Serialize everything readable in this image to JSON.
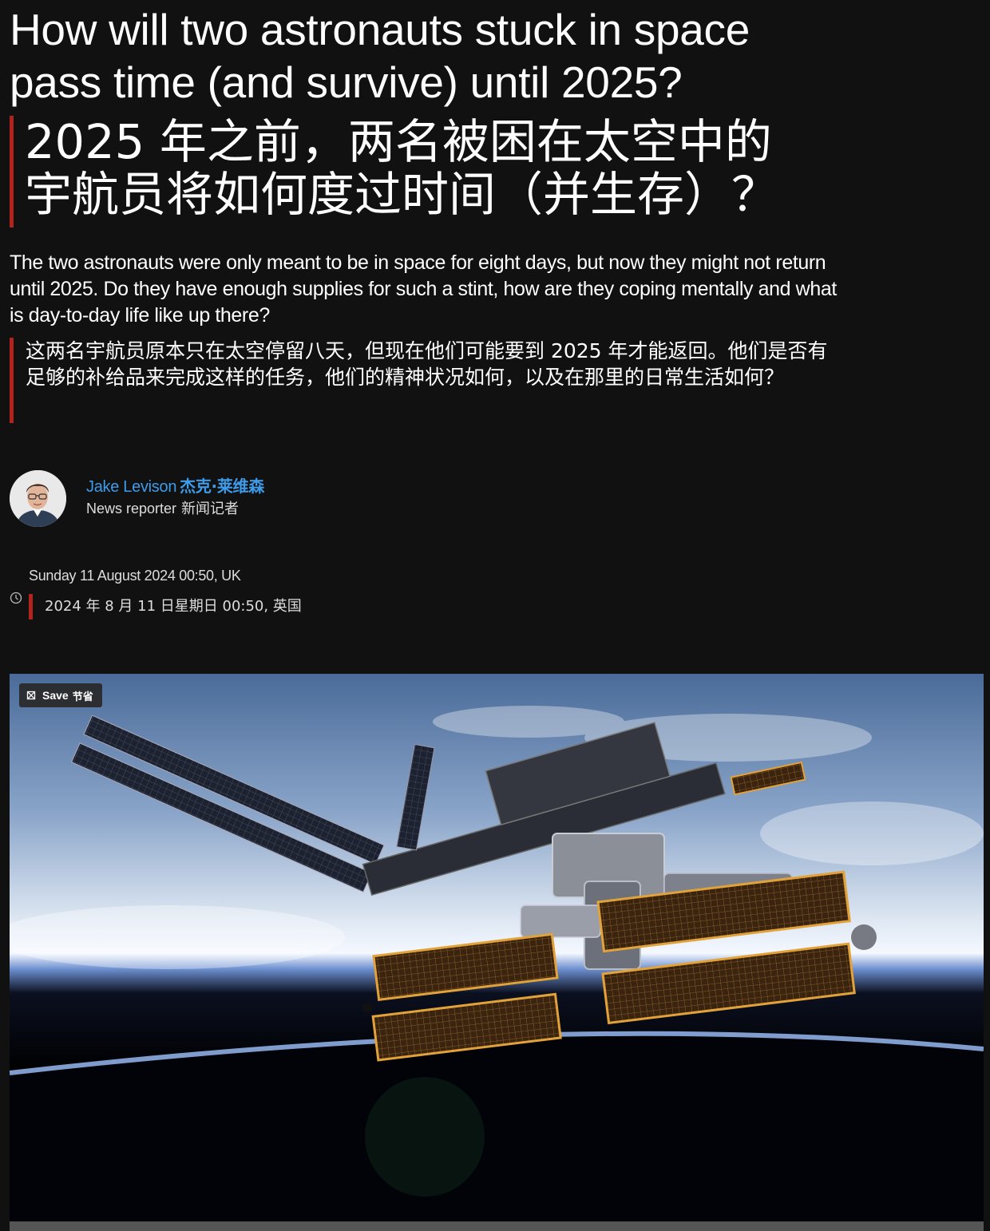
{
  "article": {
    "headline_en": "How will two astronauts stuck in space pass time (and survive) until 2025?",
    "headline_zh": "2025 年之前，两名被困在太空中的宇航员将如何度过时间（并生存）？",
    "standfirst_en": "The two astronauts were only meant to be in space for eight days, but now they might not return until 2025. Do they have enough supplies for such a stint, how are they coping mentally and what is day-to-day life like up there?",
    "standfirst_zh": "这两名宇航员原本只在太空停留八天，但现在他们可能要到 2025 年才能返回。他们是否有足够的补给品来完成这样的任务，他们的精神状况如何，以及在那里的日常生活如何？"
  },
  "author": {
    "name_en": "Jake Levison",
    "name_zh": "杰克·莱维森",
    "role_en": "News reporter",
    "role_zh": "新闻记者",
    "avatar_icon": "person-portrait"
  },
  "dateline": {
    "date_en": "Sunday 11 August 2024 00:50, UK",
    "date_zh": "2024 年 8 月 11 日星期日 00:50, 英国",
    "icon": "clock-icon"
  },
  "hero_image": {
    "save_label_en": "Save",
    "save_label_zh": "节省",
    "save_icon": "bookmark-icon"
  },
  "colors": {
    "background": "#111111",
    "accent_red": "#b3231d",
    "link_blue": "#3d9be9"
  }
}
